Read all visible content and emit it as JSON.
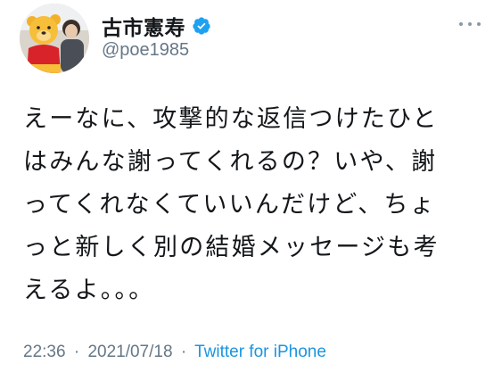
{
  "author": {
    "display_name": "古市憲寿",
    "handle": "@poe1985",
    "avatar_icon": "avatar-photo-with-bear-mascot",
    "verified_icon": "verified-badge-icon"
  },
  "menu": {
    "icon": "more-options-icon"
  },
  "tweet": {
    "lines": [
      "えーなに、攻撃的な返信つけたひと",
      "はみんな謝ってくれるの？いや、謝",
      "ってくれなくていいんだけど、ちょ",
      "っと新しく別の結婚メッセージも考",
      "えるよ。。。"
    ]
  },
  "meta": {
    "time": "22:36",
    "separator": "·",
    "date": "2021/07/18",
    "source": "Twitter for iPhone"
  },
  "colors": {
    "accent": "#1da1f2",
    "link": "#1b95e0",
    "secondary_text": "#657786",
    "text": "#14171a"
  }
}
